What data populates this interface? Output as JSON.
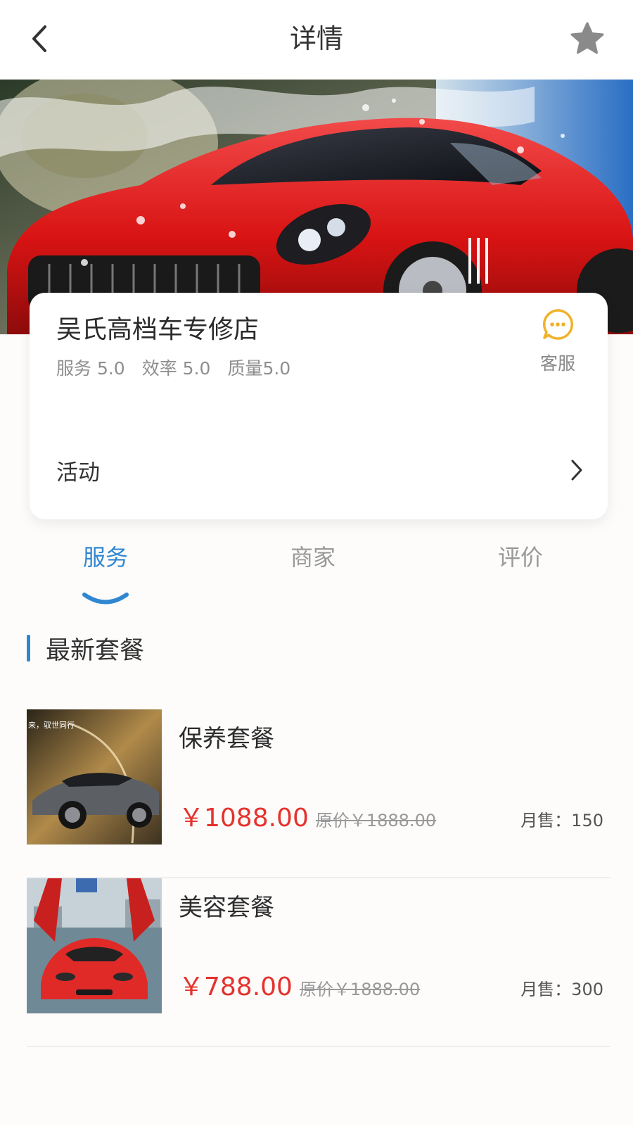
{
  "header": {
    "title": "详情",
    "back_icon": "chevron-left-icon",
    "favorite_icon": "star-icon"
  },
  "store": {
    "name": "吴氏高档车专修店",
    "ratings": [
      "服务 5.0",
      "效率 5.0",
      "质量5.0"
    ],
    "service_label": "客服",
    "activity_label": "活动"
  },
  "tabs": [
    {
      "label": "服务",
      "active": true
    },
    {
      "label": "商家",
      "active": false
    },
    {
      "label": "评价",
      "active": false
    }
  ],
  "section": {
    "title": "最新套餐"
  },
  "packages": [
    {
      "name": "保养套餐",
      "price": "￥1088.00",
      "original": "原价￥1888.00",
      "sales": "月售：150",
      "overlay_text": "来，驭世同行"
    },
    {
      "name": "美容套餐",
      "price": "￥788.00",
      "original": "原价￥1888.00",
      "sales": "月售：300"
    }
  ],
  "colors": {
    "accent": "#2f86d1",
    "price": "#e5322d",
    "chat_icon": "#f0b22a"
  }
}
